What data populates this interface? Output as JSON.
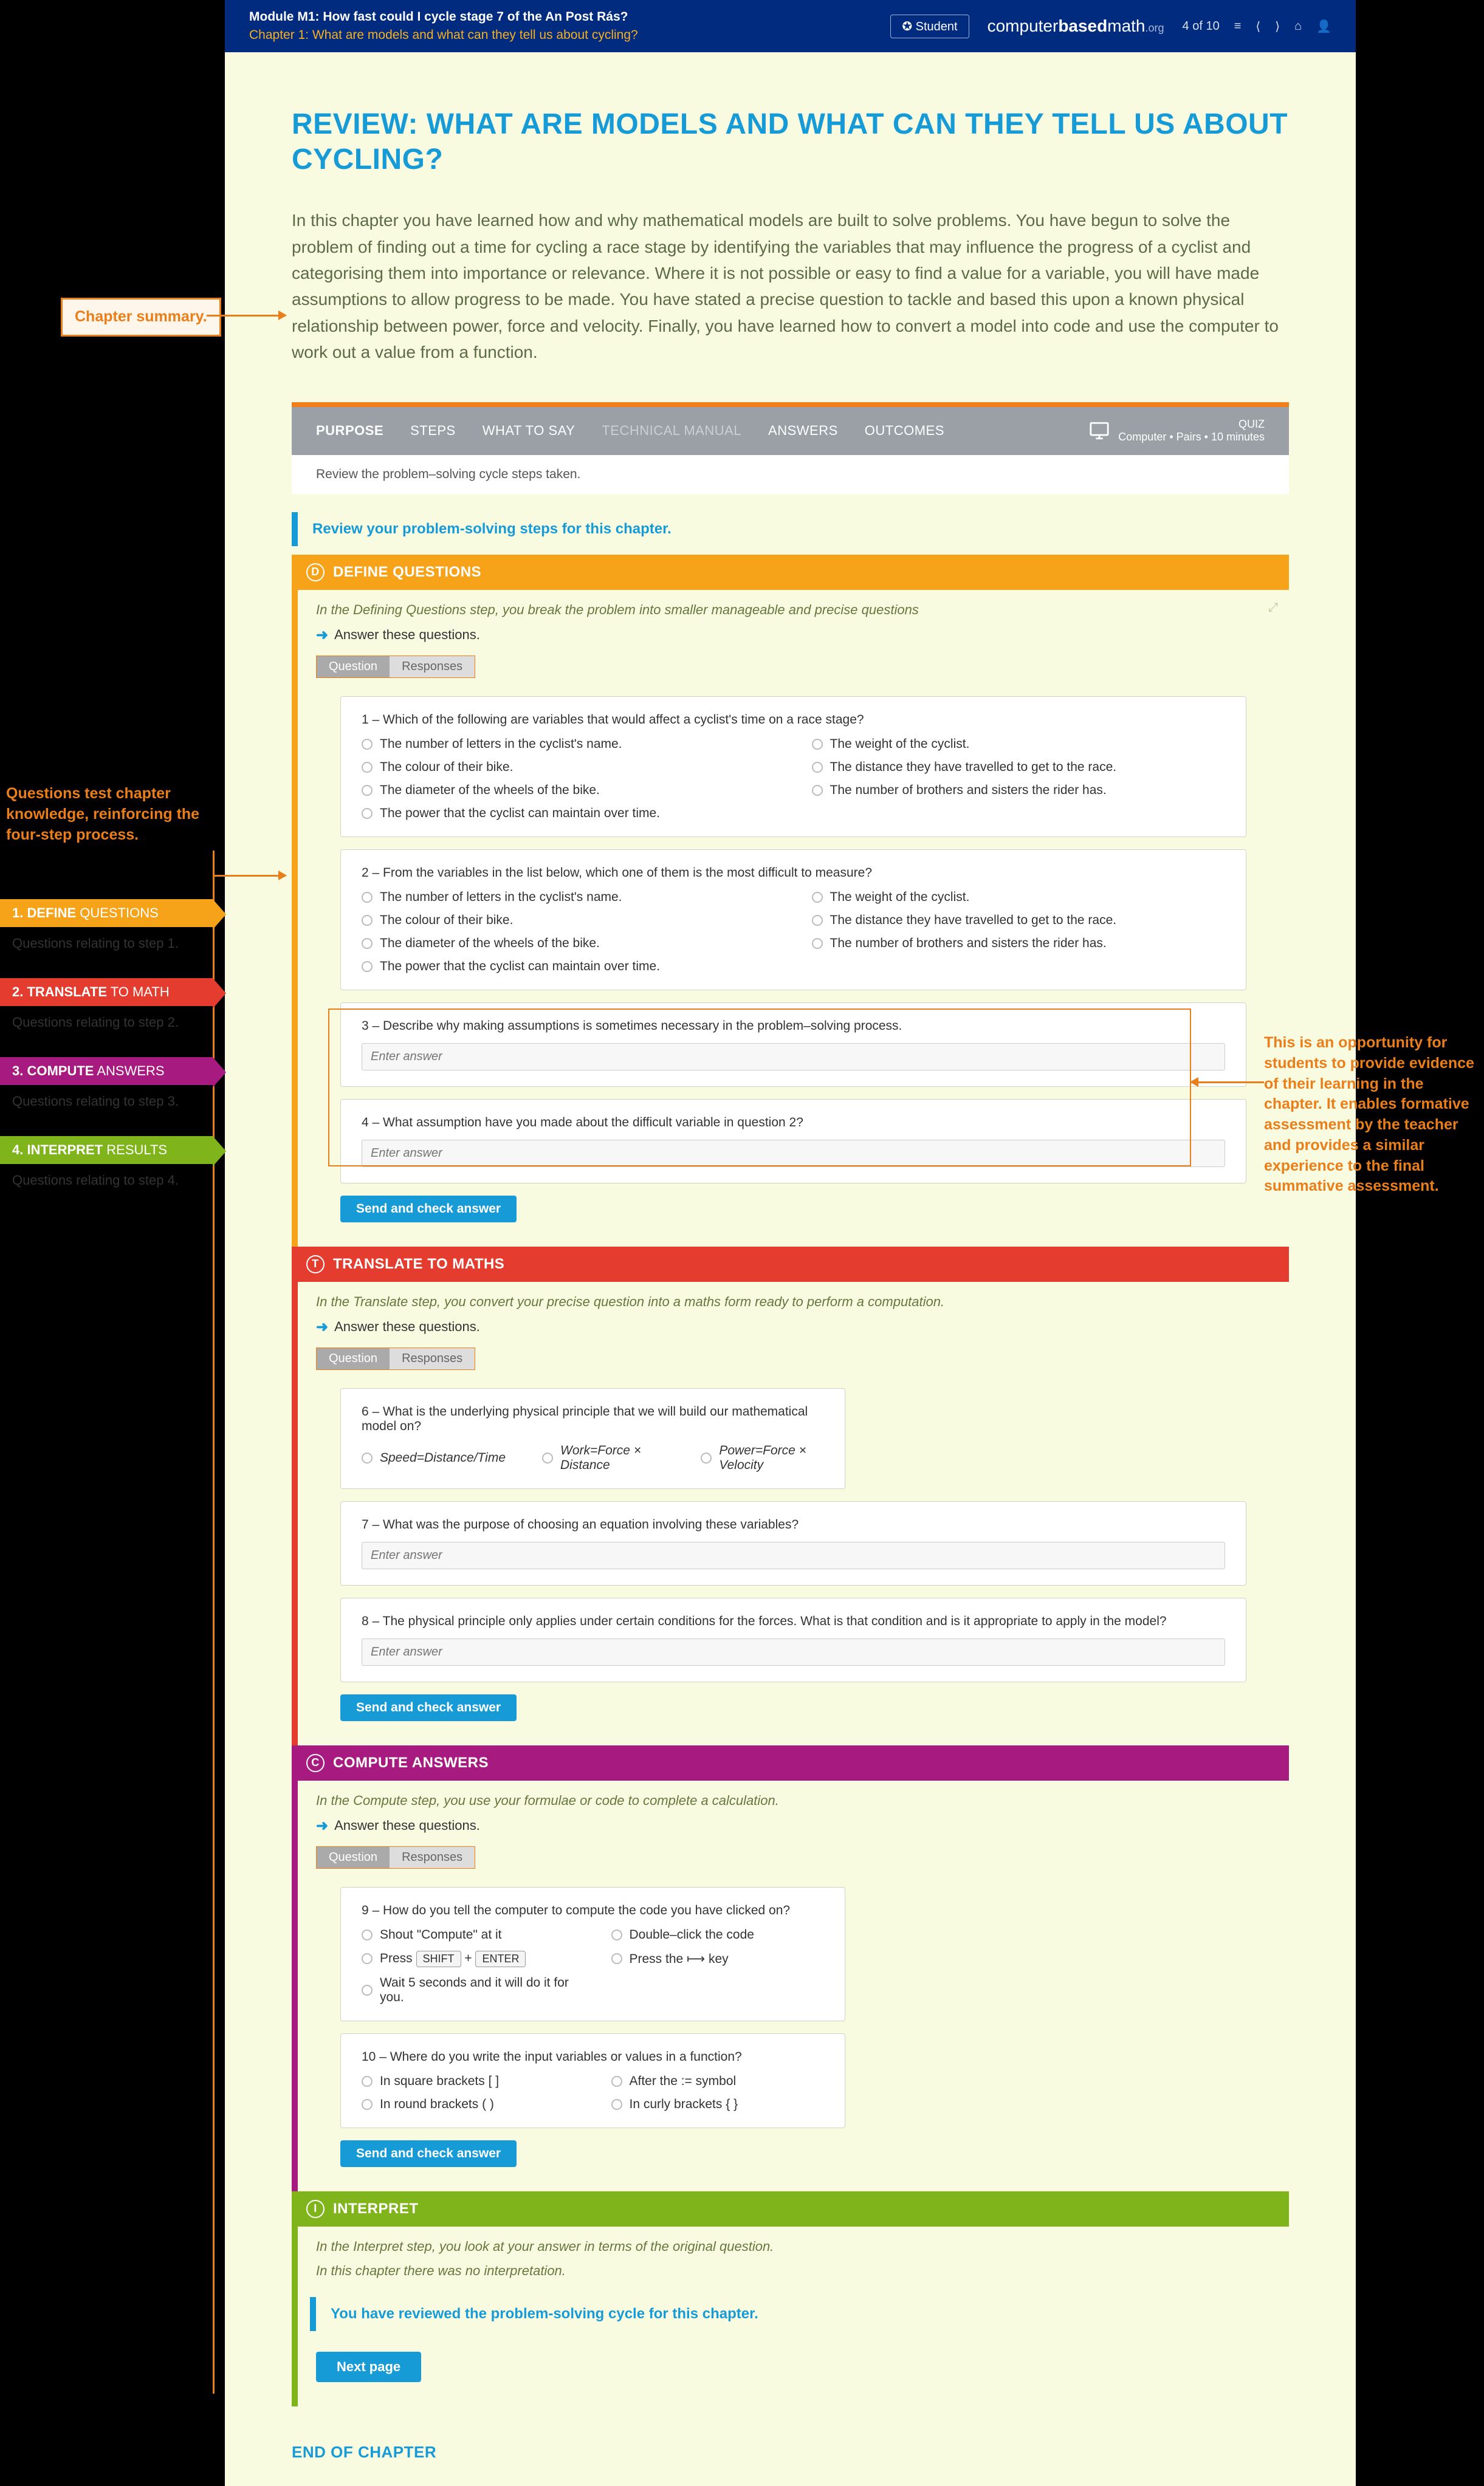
{
  "header": {
    "module": "Module M1: How fast could I cycle stage 7 of the An Post Rás?",
    "chapter": "Chapter 1: What are models and what can they tell us about cycling?",
    "student_btn": "✪ Student",
    "brand_a": "computer",
    "brand_b": "based",
    "brand_c": "math",
    "brand_org": ".org",
    "page_ind": "4 of 10",
    "nav": {
      "list": "≡",
      "first": "⟨⟨",
      "prev": "⟨",
      "next": "⟩",
      "home": "⌂",
      "user": "👤"
    }
  },
  "title": "REVIEW: WHAT ARE MODELS AND WHAT CAN THEY TELL US ABOUT CYCLING?",
  "summary": "In this chapter you have learned how and why mathematical models are built to solve problems. You have begun to solve the problem of finding out a time for cycling a race stage by identifying the variables that may influence the progress of a cyclist and categorising them into importance or relevance. Where it is not possible or easy to find a value for a variable, you will have made assumptions to allow progress to be made. You have stated a precise question to tackle and based this upon a known physical relationship between power, force and velocity. Finally, you have learned how to convert a model into code and use the computer to work out a value from a function.",
  "tabs": {
    "purpose": "PURPOSE",
    "steps": "STEPS",
    "say": "WHAT TO SAY",
    "tech": "TECHNICAL MANUAL",
    "answers": "ANSWERS",
    "outcomes": "OUTCOMES",
    "quiz_title": "QUIZ",
    "quiz_sub": "Computer • Pairs • 10 minutes"
  },
  "subnote": "Review the problem–solving cycle steps taken.",
  "review_strip": "Review your problem-solving steps for this chapter.",
  "qr": {
    "q": "Question",
    "r": "Responses"
  },
  "answer_these": "Answer these questions.",
  "send": "Send and check answer",
  "placeholder": "Enter answer",
  "sections": {
    "d": {
      "label": "DEFINE QUESTIONS",
      "letter": "D",
      "desc": "In the Defining Questions step, you break the problem into smaller manageable and precise questions"
    },
    "t": {
      "label": "TRANSLATE TO MATHS",
      "letter": "T",
      "desc": "In the Translate step, you convert your precise question into a maths form ready to perform a computation."
    },
    "c": {
      "label": "COMPUTE ANSWERS",
      "letter": "C",
      "desc": "In the Compute step, you use your formulae or code to complete a calculation."
    },
    "i": {
      "label": "INTERPRET",
      "letter": "I",
      "desc": "In the Interpret step, you look at your answer in terms of the original question.",
      "note": "In this chapter there was no interpretation.",
      "done": "You have reviewed the problem-solving cycle for this chapter."
    }
  },
  "q1": {
    "text": "1 – Which of the following are variables that would affect a cyclist's time on a race stage?",
    "opts": [
      "The number of letters in the cyclist's name.",
      "The weight of the cyclist.",
      "The colour of their bike.",
      "The distance they have travelled to get to the race.",
      "The diameter of the wheels of the bike.",
      "The number of brothers and sisters the rider has.",
      "The power that the cyclist can maintain over time."
    ]
  },
  "q2": {
    "text": "2 – From the variables in the list below, which one of them is the most difficult to measure?",
    "opts": [
      "The number of letters in the cyclist's name.",
      "The weight of the cyclist.",
      "The colour of their bike.",
      "The distance they have travelled to get to the race.",
      "The diameter of the wheels of the bike.",
      "The number of brothers and sisters the rider has.",
      "The power that the cyclist can maintain over time."
    ]
  },
  "q3": {
    "text": "3 – Describe why making assumptions is sometimes necessary in the problem–solving process."
  },
  "q4": {
    "text": "4 – What assumption have you made about the difficult variable in question 2?"
  },
  "q6": {
    "text": "6 – What is the underlying physical principle that we will build our mathematical model on?",
    "opts": [
      "Speed=Distance/Time",
      "Work=Force × Distance",
      "Power=Force × Velocity"
    ]
  },
  "q7": {
    "text": "7 – What was the purpose of choosing an equation involving these variables?"
  },
  "q8": {
    "text": "8 – The physical principle only applies under certain conditions for the forces. What is that condition and is it appropriate to apply in the model?"
  },
  "q9": {
    "text": "9 – How do you tell the computer to compute the code you have clicked on?",
    "opts_html": [
      "Shout \"Compute\" at it",
      "Double–click the code",
      "Press |SHIFT| + |ENTER|",
      "Press the ⟼ key",
      "Wait 5 seconds and it will do it for you."
    ]
  },
  "q10": {
    "text": "10 – Where do you write the input variables or values in a function?",
    "opts": [
      "In square brackets [ ]",
      "After the := symbol",
      "In round brackets ( )",
      "In curly brackets { }"
    ]
  },
  "next": "Next page",
  "eoc": "END OF CHAPTER",
  "annots": {
    "summary": "Chapter summary.",
    "left": "Questions test chapter knowledge, reinforcing the four-step process.",
    "right": "This is an opportunity for students to provide evidence of their learning in the chapter. It enables formative assessment by the teacher and provides a similar experience to the final summative assessment."
  },
  "chevrons": {
    "d_b": "1. DEFINE",
    "d_l": " QUESTIONS",
    "d_sub": "Questions relating to step 1.",
    "t_b": "2. TRANSLATE",
    "t_l": " TO MATH",
    "t_sub": "Questions relating to step 2.",
    "c_b": "3. COMPUTE",
    "c_l": " ANSWERS",
    "c_sub": "Questions relating to step 3.",
    "i_b": "4. INTERPRET",
    "i_l": " RESULTS",
    "i_sub": "Questions relating to step 4."
  }
}
